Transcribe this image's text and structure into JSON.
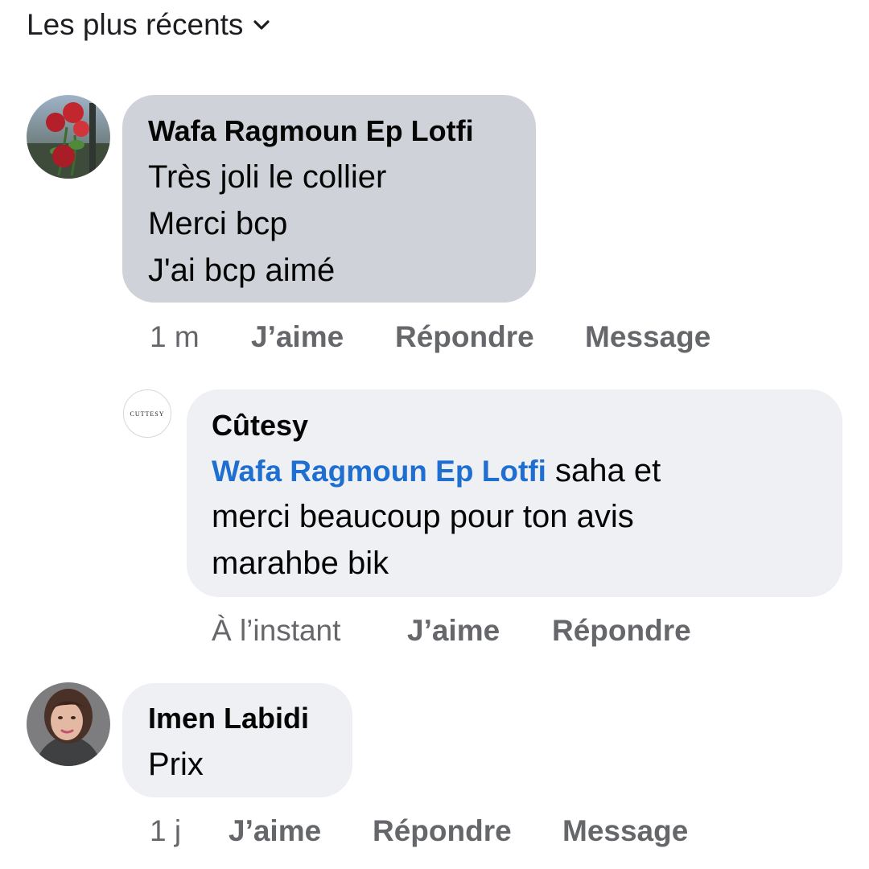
{
  "sort": {
    "label": "Les plus récents",
    "icon": "chevron-down-icon"
  },
  "comments": [
    {
      "author": "Wafa Ragmoun Ep Lotfi",
      "avatar_icon": "rose-photo-avatar",
      "lines": [
        "Très joli le collier",
        "Merci bcp",
        "J'ai bcp aimé"
      ],
      "time": "1 m",
      "like_label": "J’aime",
      "reply_label": "Répondre",
      "message_label": "Message",
      "reply": {
        "author": "Cûtesy",
        "avatar_text": "CUTTESY",
        "mention": "Wafa Ragmoun Ep Lotfi",
        "line1_rest": " saha et",
        "line2": "merci beaucoup pour ton avis",
        "line3": "marahbe bik",
        "time": "À l’instant",
        "like_label": "J’aime",
        "reply_label": "Répondre"
      }
    },
    {
      "author": "Imen Labidi",
      "avatar_icon": "woman-photo-avatar",
      "lines": [
        "Prix"
      ],
      "time": "1 j",
      "like_label": "J’aime",
      "reply_label": "Répondre",
      "message_label": "Message"
    }
  ],
  "colors": {
    "bubble_gray": "#cfd2d8",
    "bubble_light": "#eef0f4",
    "mention_blue": "#1f6fd1",
    "meta_gray": "#65676b"
  }
}
